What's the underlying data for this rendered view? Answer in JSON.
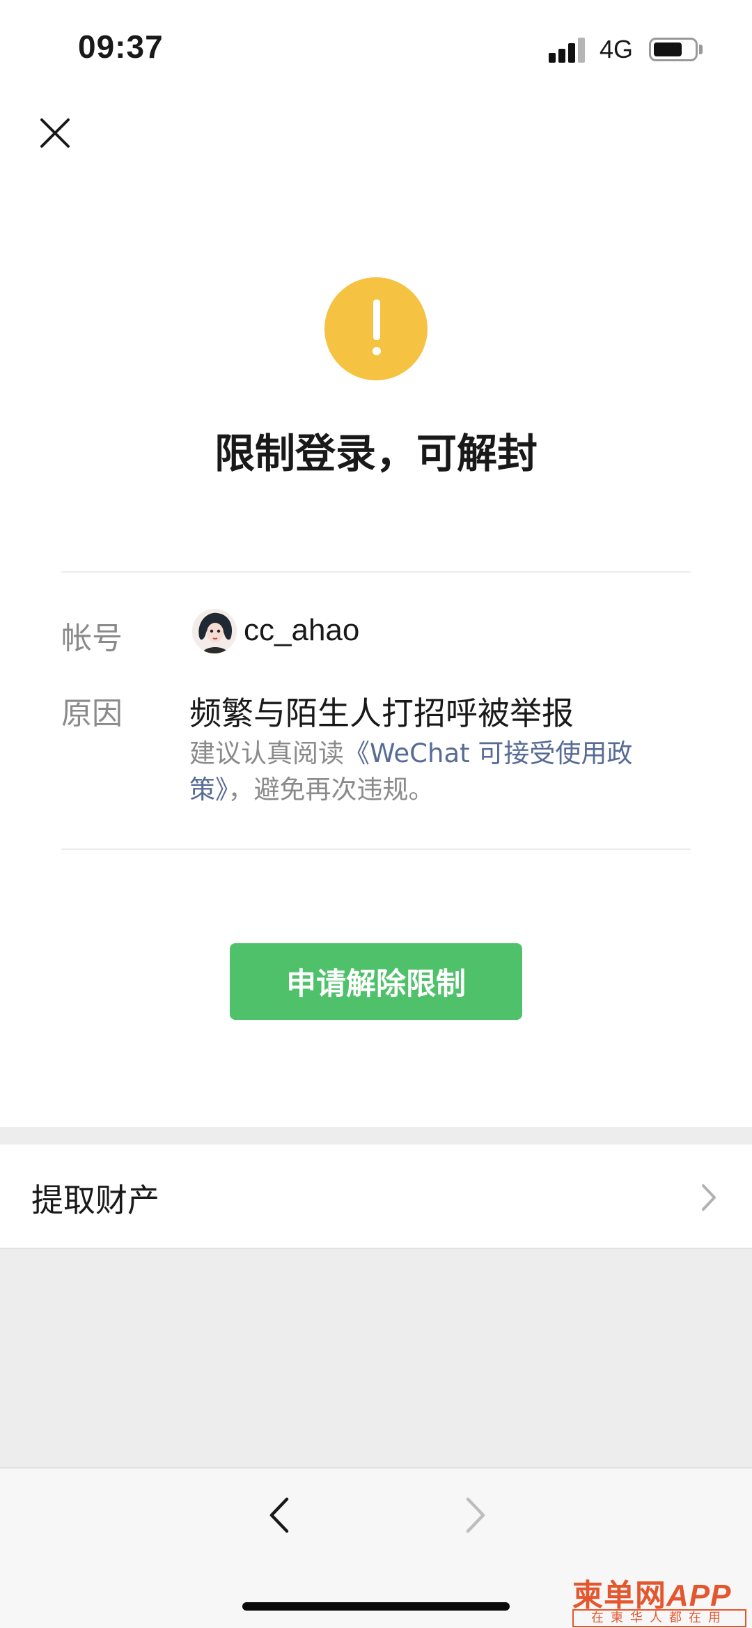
{
  "status_bar": {
    "time": "09:37",
    "network": "4G",
    "icons": [
      "signal-icon",
      "battery-icon"
    ]
  },
  "header": {
    "close_icon": "close-icon"
  },
  "notice": {
    "icon": "warning-icon",
    "icon_color": "#f5c242",
    "title": "限制登录，可解封"
  },
  "details": {
    "account_label": "帐号",
    "account_name": "cc_ahao",
    "reason_label": "原因",
    "reason_text": "频繁与陌生人打招呼被举报",
    "hint_prefix": "建议认真阅读",
    "hint_link": "《WeChat 可接受使用政策》",
    "hint_suffix": "，避免再次违规。",
    "link_color": "#576b95"
  },
  "actions": {
    "primary_label": "申请解除限制",
    "primary_color": "#4fc16a"
  },
  "list": {
    "items": [
      {
        "label": "提取财产",
        "icon": "chevron-right-icon"
      }
    ]
  },
  "browser_nav": {
    "back_icon": "chevron-left-icon",
    "forward_icon": "chevron-right-icon"
  },
  "watermark": {
    "brand": "柬单网",
    "suffix": "APP",
    "tagline": "在柬华人都在用",
    "color": "#e4572e"
  }
}
